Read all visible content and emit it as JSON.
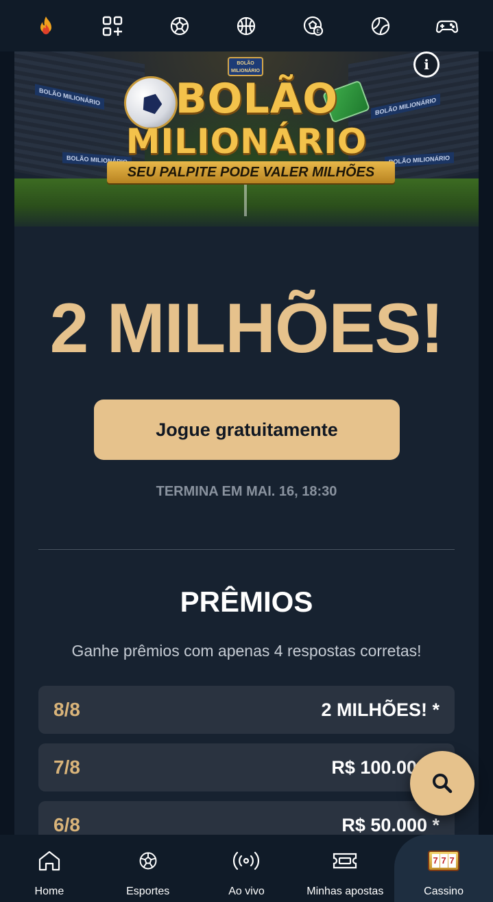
{
  "top_nav": {
    "items": [
      {
        "icon": "fire-icon"
      },
      {
        "icon": "grid-plus-icon"
      },
      {
        "icon": "soccer-ball-icon"
      },
      {
        "icon": "basketball-icon"
      },
      {
        "icon": "esports-ball-icon"
      },
      {
        "icon": "tennis-ball-icon"
      },
      {
        "icon": "gamepad-icon"
      }
    ]
  },
  "banner": {
    "small_logo_line1": "BOLÃO",
    "small_logo_line2": "MILIONÁRIO",
    "title_line1": "BOLÃO",
    "title_line2": "MILIONÁRIO",
    "tagline": "SEU PALPITE PODE VALER MILHÕES",
    "ad_board_text": "BOLÃO MILIONÁRIO",
    "info_icon": "info-icon"
  },
  "hero": {
    "headline": "2 MILHÕES!",
    "cta_label": "Jogue gratuitamente",
    "ends_text": "TERMINA EM MAI. 16, 18:30"
  },
  "prizes": {
    "title": "PRÊMIOS",
    "subtitle": "Ganhe prêmios com apenas 4 respostas corretas!",
    "rows": [
      {
        "hits": "8/8",
        "amount": "2 MILHÕES! *"
      },
      {
        "hits": "7/8",
        "amount": "R$ 100.000 *"
      },
      {
        "hits": "6/8",
        "amount": "R$ 50.000 *"
      }
    ]
  },
  "search_button": {
    "icon": "search-icon"
  },
  "bottom_nav": {
    "items": [
      {
        "label": "Home",
        "icon": "home-icon"
      },
      {
        "label": "Esportes",
        "icon": "soccer-ball-icon"
      },
      {
        "label": "Ao vivo",
        "icon": "live-broadcast-icon"
      },
      {
        "label": "Minhas apostas",
        "icon": "ticket-icon"
      },
      {
        "label": "Cassino",
        "icon": "slot-machine-icon",
        "active": true
      }
    ]
  },
  "colors": {
    "background": "#0b1420",
    "panel": "#172230",
    "accent_gold": "#e6c28c",
    "row_bg": "#2a3340",
    "nav_bg": "#101b28"
  }
}
